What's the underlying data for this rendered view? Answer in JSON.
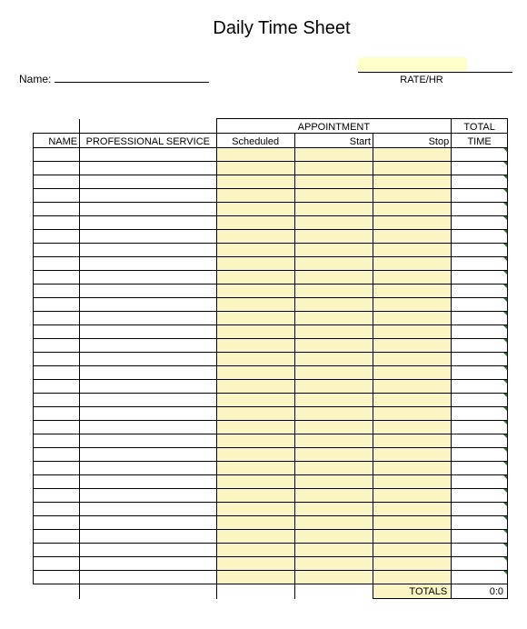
{
  "title": "Daily Time Sheet",
  "header": {
    "name_label": "Name:",
    "name_value": "",
    "rate_label": "RATE/HR",
    "rate_value": ""
  },
  "columns": {
    "name": "NAME",
    "professional_service": "PROFESSIONAL SERVICE",
    "appointment": "APPOINTMENT",
    "scheduled": "Scheduled",
    "start": "Start",
    "stop": "Stop",
    "total_time_1": "TOTAL",
    "total_time_2": "TIME"
  },
  "rows": [
    {
      "name": "",
      "service": "",
      "scheduled": "",
      "start": "",
      "stop": "",
      "total": ""
    },
    {
      "name": "",
      "service": "",
      "scheduled": "",
      "start": "",
      "stop": "",
      "total": ""
    },
    {
      "name": "",
      "service": "",
      "scheduled": "",
      "start": "",
      "stop": "",
      "total": ""
    },
    {
      "name": "",
      "service": "",
      "scheduled": "",
      "start": "",
      "stop": "",
      "total": ""
    },
    {
      "name": "",
      "service": "",
      "scheduled": "",
      "start": "",
      "stop": "",
      "total": ""
    },
    {
      "name": "",
      "service": "",
      "scheduled": "",
      "start": "",
      "stop": "",
      "total": ""
    },
    {
      "name": "",
      "service": "",
      "scheduled": "",
      "start": "",
      "stop": "",
      "total": ""
    },
    {
      "name": "",
      "service": "",
      "scheduled": "",
      "start": "",
      "stop": "",
      "total": ""
    },
    {
      "name": "",
      "service": "",
      "scheduled": "",
      "start": "",
      "stop": "",
      "total": ""
    },
    {
      "name": "",
      "service": "",
      "scheduled": "",
      "start": "",
      "stop": "",
      "total": ""
    },
    {
      "name": "",
      "service": "",
      "scheduled": "",
      "start": "",
      "stop": "",
      "total": ""
    },
    {
      "name": "",
      "service": "",
      "scheduled": "",
      "start": "",
      "stop": "",
      "total": ""
    },
    {
      "name": "",
      "service": "",
      "scheduled": "",
      "start": "",
      "stop": "",
      "total": ""
    },
    {
      "name": "",
      "service": "",
      "scheduled": "",
      "start": "",
      "stop": "",
      "total": ""
    },
    {
      "name": "",
      "service": "",
      "scheduled": "",
      "start": "",
      "stop": "",
      "total": ""
    },
    {
      "name": "",
      "service": "",
      "scheduled": "",
      "start": "",
      "stop": "",
      "total": ""
    },
    {
      "name": "",
      "service": "",
      "scheduled": "",
      "start": "",
      "stop": "",
      "total": ""
    },
    {
      "name": "",
      "service": "",
      "scheduled": "",
      "start": "",
      "stop": "",
      "total": ""
    },
    {
      "name": "",
      "service": "",
      "scheduled": "",
      "start": "",
      "stop": "",
      "total": ""
    },
    {
      "name": "",
      "service": "",
      "scheduled": "",
      "start": "",
      "stop": "",
      "total": ""
    },
    {
      "name": "",
      "service": "",
      "scheduled": "",
      "start": "",
      "stop": "",
      "total": ""
    },
    {
      "name": "",
      "service": "",
      "scheduled": "",
      "start": "",
      "stop": "",
      "total": ""
    },
    {
      "name": "",
      "service": "",
      "scheduled": "",
      "start": "",
      "stop": "",
      "total": ""
    },
    {
      "name": "",
      "service": "",
      "scheduled": "",
      "start": "",
      "stop": "",
      "total": ""
    },
    {
      "name": "",
      "service": "",
      "scheduled": "",
      "start": "",
      "stop": "",
      "total": ""
    },
    {
      "name": "",
      "service": "",
      "scheduled": "",
      "start": "",
      "stop": "",
      "total": ""
    },
    {
      "name": "",
      "service": "",
      "scheduled": "",
      "start": "",
      "stop": "",
      "total": ""
    },
    {
      "name": "",
      "service": "",
      "scheduled": "",
      "start": "",
      "stop": "",
      "total": ""
    },
    {
      "name": "",
      "service": "",
      "scheduled": "",
      "start": "",
      "stop": "",
      "total": ""
    },
    {
      "name": "",
      "service": "",
      "scheduled": "",
      "start": "",
      "stop": "",
      "total": ""
    },
    {
      "name": "",
      "service": "",
      "scheduled": "",
      "start": "",
      "stop": "",
      "total": ""
    },
    {
      "name": "",
      "service": "",
      "scheduled": "",
      "start": "",
      "stop": "",
      "total": ""
    }
  ],
  "totals": {
    "label": "TOTALS",
    "value": "0:0"
  }
}
